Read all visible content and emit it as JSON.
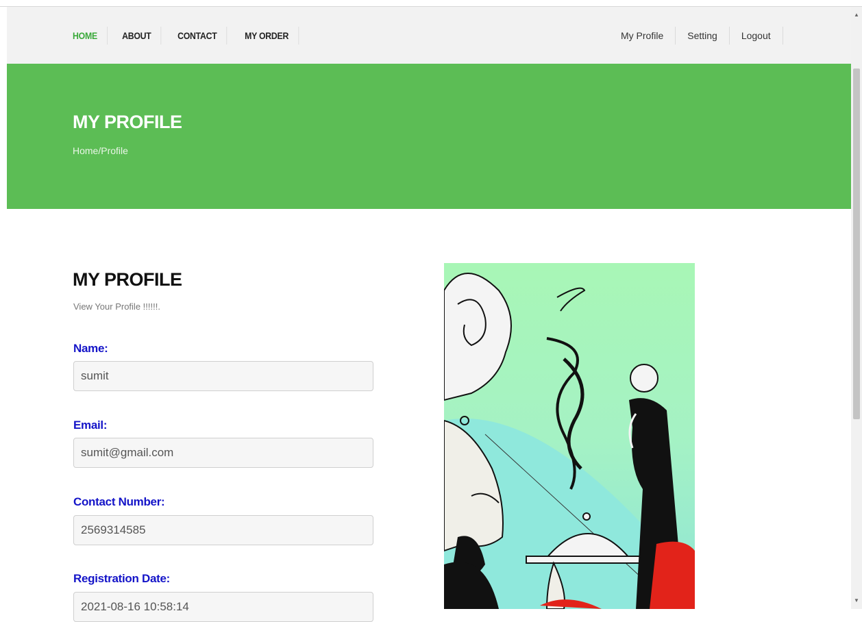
{
  "nav": {
    "left": [
      "HOME",
      "ABOUT",
      "CONTACT",
      "MY ORDER"
    ],
    "right": [
      "My Profile",
      "Setting",
      "Logout"
    ],
    "active_color": "#3aa93a"
  },
  "banner": {
    "title": "MY PROFILE",
    "breadcrumb": "Home/Profile",
    "color": "#5cbd55"
  },
  "profile": {
    "title": "MY PROFILE",
    "subtitle": "View Your Profile !!!!!!.",
    "fields": [
      {
        "label": "Name:",
        "value": "sumit"
      },
      {
        "label": "Email:",
        "value": "sumit@gmail.com"
      },
      {
        "label": "Contact Number:",
        "value": "2569314585"
      },
      {
        "label": "Registration Date:",
        "value": "2021-08-16 10:58:14"
      }
    ]
  },
  "illustration": {
    "alt": "chef serving dish illustration"
  },
  "scrollbar": {
    "up_icon": "arrow-up-icon",
    "down_icon": "arrow-down-icon"
  }
}
